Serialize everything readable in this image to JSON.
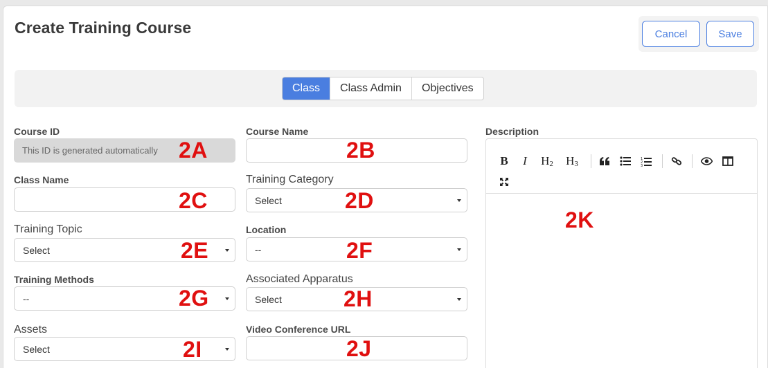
{
  "header": {
    "title": "Create Training Course"
  },
  "actions": {
    "cancel_label": "Cancel",
    "save_label": "Save"
  },
  "tabs": [
    {
      "label": "Class",
      "active": true
    },
    {
      "label": "Class Admin",
      "active": false
    },
    {
      "label": "Objectives",
      "active": false
    }
  ],
  "form": {
    "course_id": {
      "label": "Course ID",
      "value": "This ID is generated automatically",
      "marker": "2A"
    },
    "course_name": {
      "label": "Course Name",
      "value": "",
      "marker": "2B"
    },
    "class_name": {
      "label": "Class Name",
      "value": "",
      "marker": "2C"
    },
    "training_category": {
      "label": "Training Category",
      "selected": "Select",
      "marker": "2D"
    },
    "training_topic": {
      "label": "Training Topic",
      "selected": "Select",
      "marker": "2E"
    },
    "location": {
      "label": "Location",
      "selected": "--",
      "marker": "2F"
    },
    "training_methods": {
      "label": "Training Methods",
      "selected": "--",
      "marker": "2G"
    },
    "associated_apparatus": {
      "label": "Associated Apparatus",
      "selected": "Select",
      "marker": "2H"
    },
    "assets": {
      "label": "Assets",
      "selected": "Select",
      "marker": "2I"
    },
    "video_conference_url": {
      "label": "Video Conference URL",
      "value": "",
      "marker": "2J"
    },
    "description": {
      "label": "Description",
      "value": "",
      "marker": "2K"
    }
  },
  "editor_toolbar": {
    "bold": "B",
    "italic": "I",
    "h2": "H",
    "h2_sub": "2",
    "h3": "H",
    "h3_sub": "3",
    "icons": [
      "bold-icon",
      "italic-icon",
      "heading-2-icon",
      "heading-3-icon",
      "quote-icon",
      "unordered-list-icon",
      "ordered-list-icon",
      "link-icon",
      "preview-icon",
      "side-by-side-icon",
      "fullscreen-icon"
    ]
  },
  "colors": {
    "accent": "#4a7ee0",
    "marker": "#e01010",
    "disabled_bg": "#d9d9d9"
  }
}
